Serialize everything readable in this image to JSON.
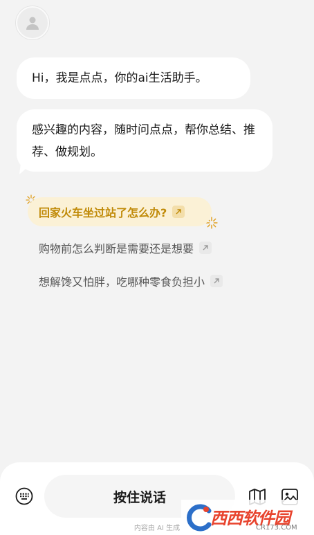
{
  "chat": {
    "greeting": "Hi，我是点点，你的ai生活助手。",
    "intro": "感兴趣的内容，随时问点点，帮你总结、推荐、做规划。"
  },
  "suggestions": [
    {
      "text": "回家火车坐过站了怎么办?",
      "icon": "arrow-up-right-icon",
      "highlighted": true
    },
    {
      "text": "购物前怎么判断是需要还是想要",
      "icon": "arrow-up-right-icon",
      "highlighted": false
    },
    {
      "text": "想解馋又怕胖，吃哪种零食负担小",
      "icon": "arrow-up-right-icon",
      "highlighted": false
    }
  ],
  "bottom_bar": {
    "talk_label": "按住说话",
    "disclaimer": "内容由 AI 生成"
  },
  "watermark": {
    "brand": "西西软件园",
    "site": "CR173.COM"
  },
  "colors": {
    "background": "#f3f3f3",
    "bubble": "#ffffff",
    "highlight_bg": "#fbf1d6",
    "highlight_text": "#c08a08",
    "watermark_blue": "#2c6fc9",
    "watermark_red": "#e8442e"
  },
  "icons": [
    "avatar-icon",
    "keyboard-icon",
    "map-icon",
    "image-icon",
    "sparkle-icon",
    "arrow-up-right-icon"
  ]
}
